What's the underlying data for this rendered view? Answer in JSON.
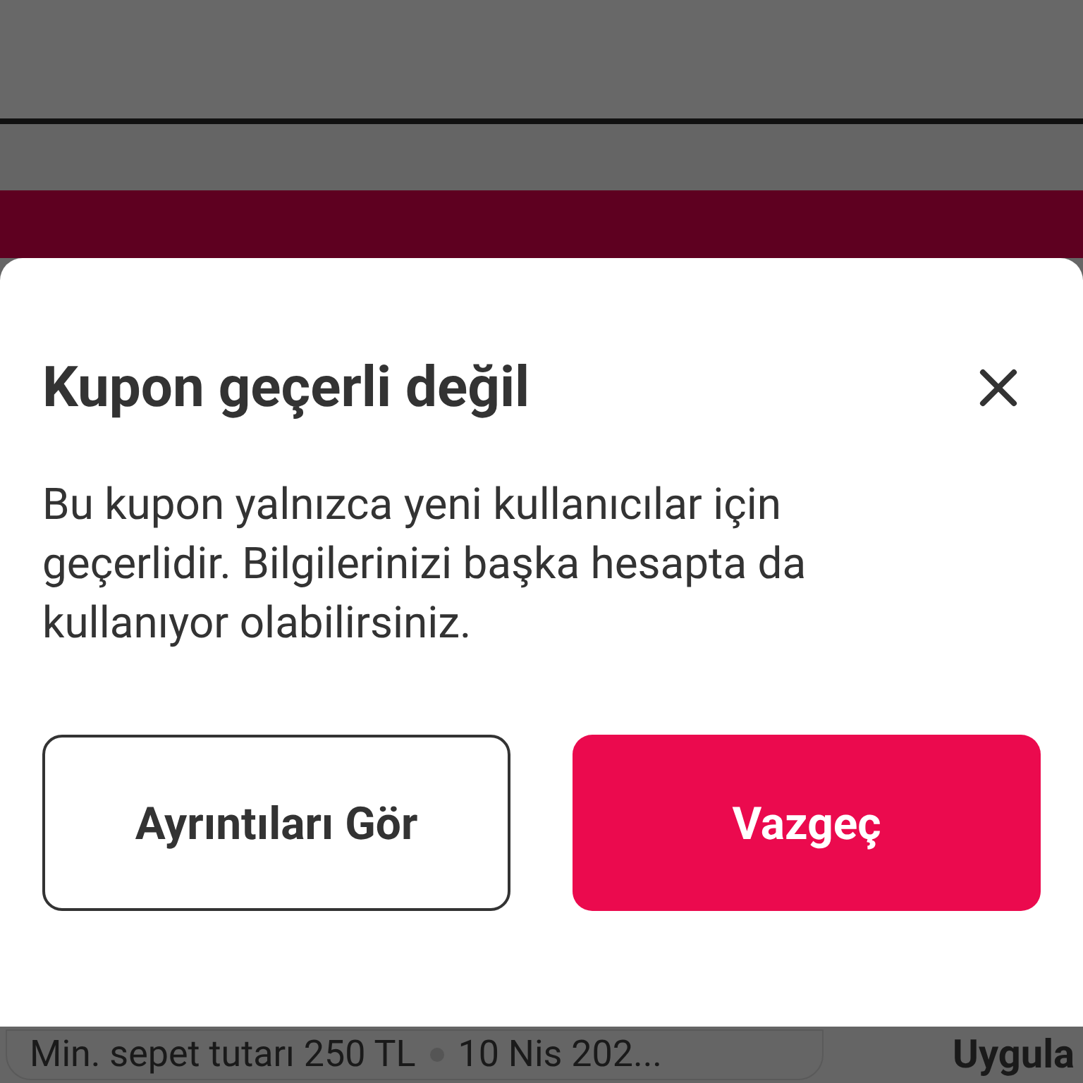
{
  "dialog": {
    "title": "Kupon geçerli değil",
    "message": "Bu kupon yalnızca yeni kullanıcılar için geçerlidir. Bilgilerinizi başka hesapta da kullanıyor olabilirsiniz.",
    "buttons": [
      {
        "label": "Ayrıntıları Gör",
        "kind": "outline"
      },
      {
        "label": "Vazgeç",
        "kind": "primary"
      }
    ]
  },
  "coupon": {
    "condition": "Min. sepet tutarı 250 TL",
    "date": "10 Nis 202...",
    "apply": "Uygula"
  }
}
